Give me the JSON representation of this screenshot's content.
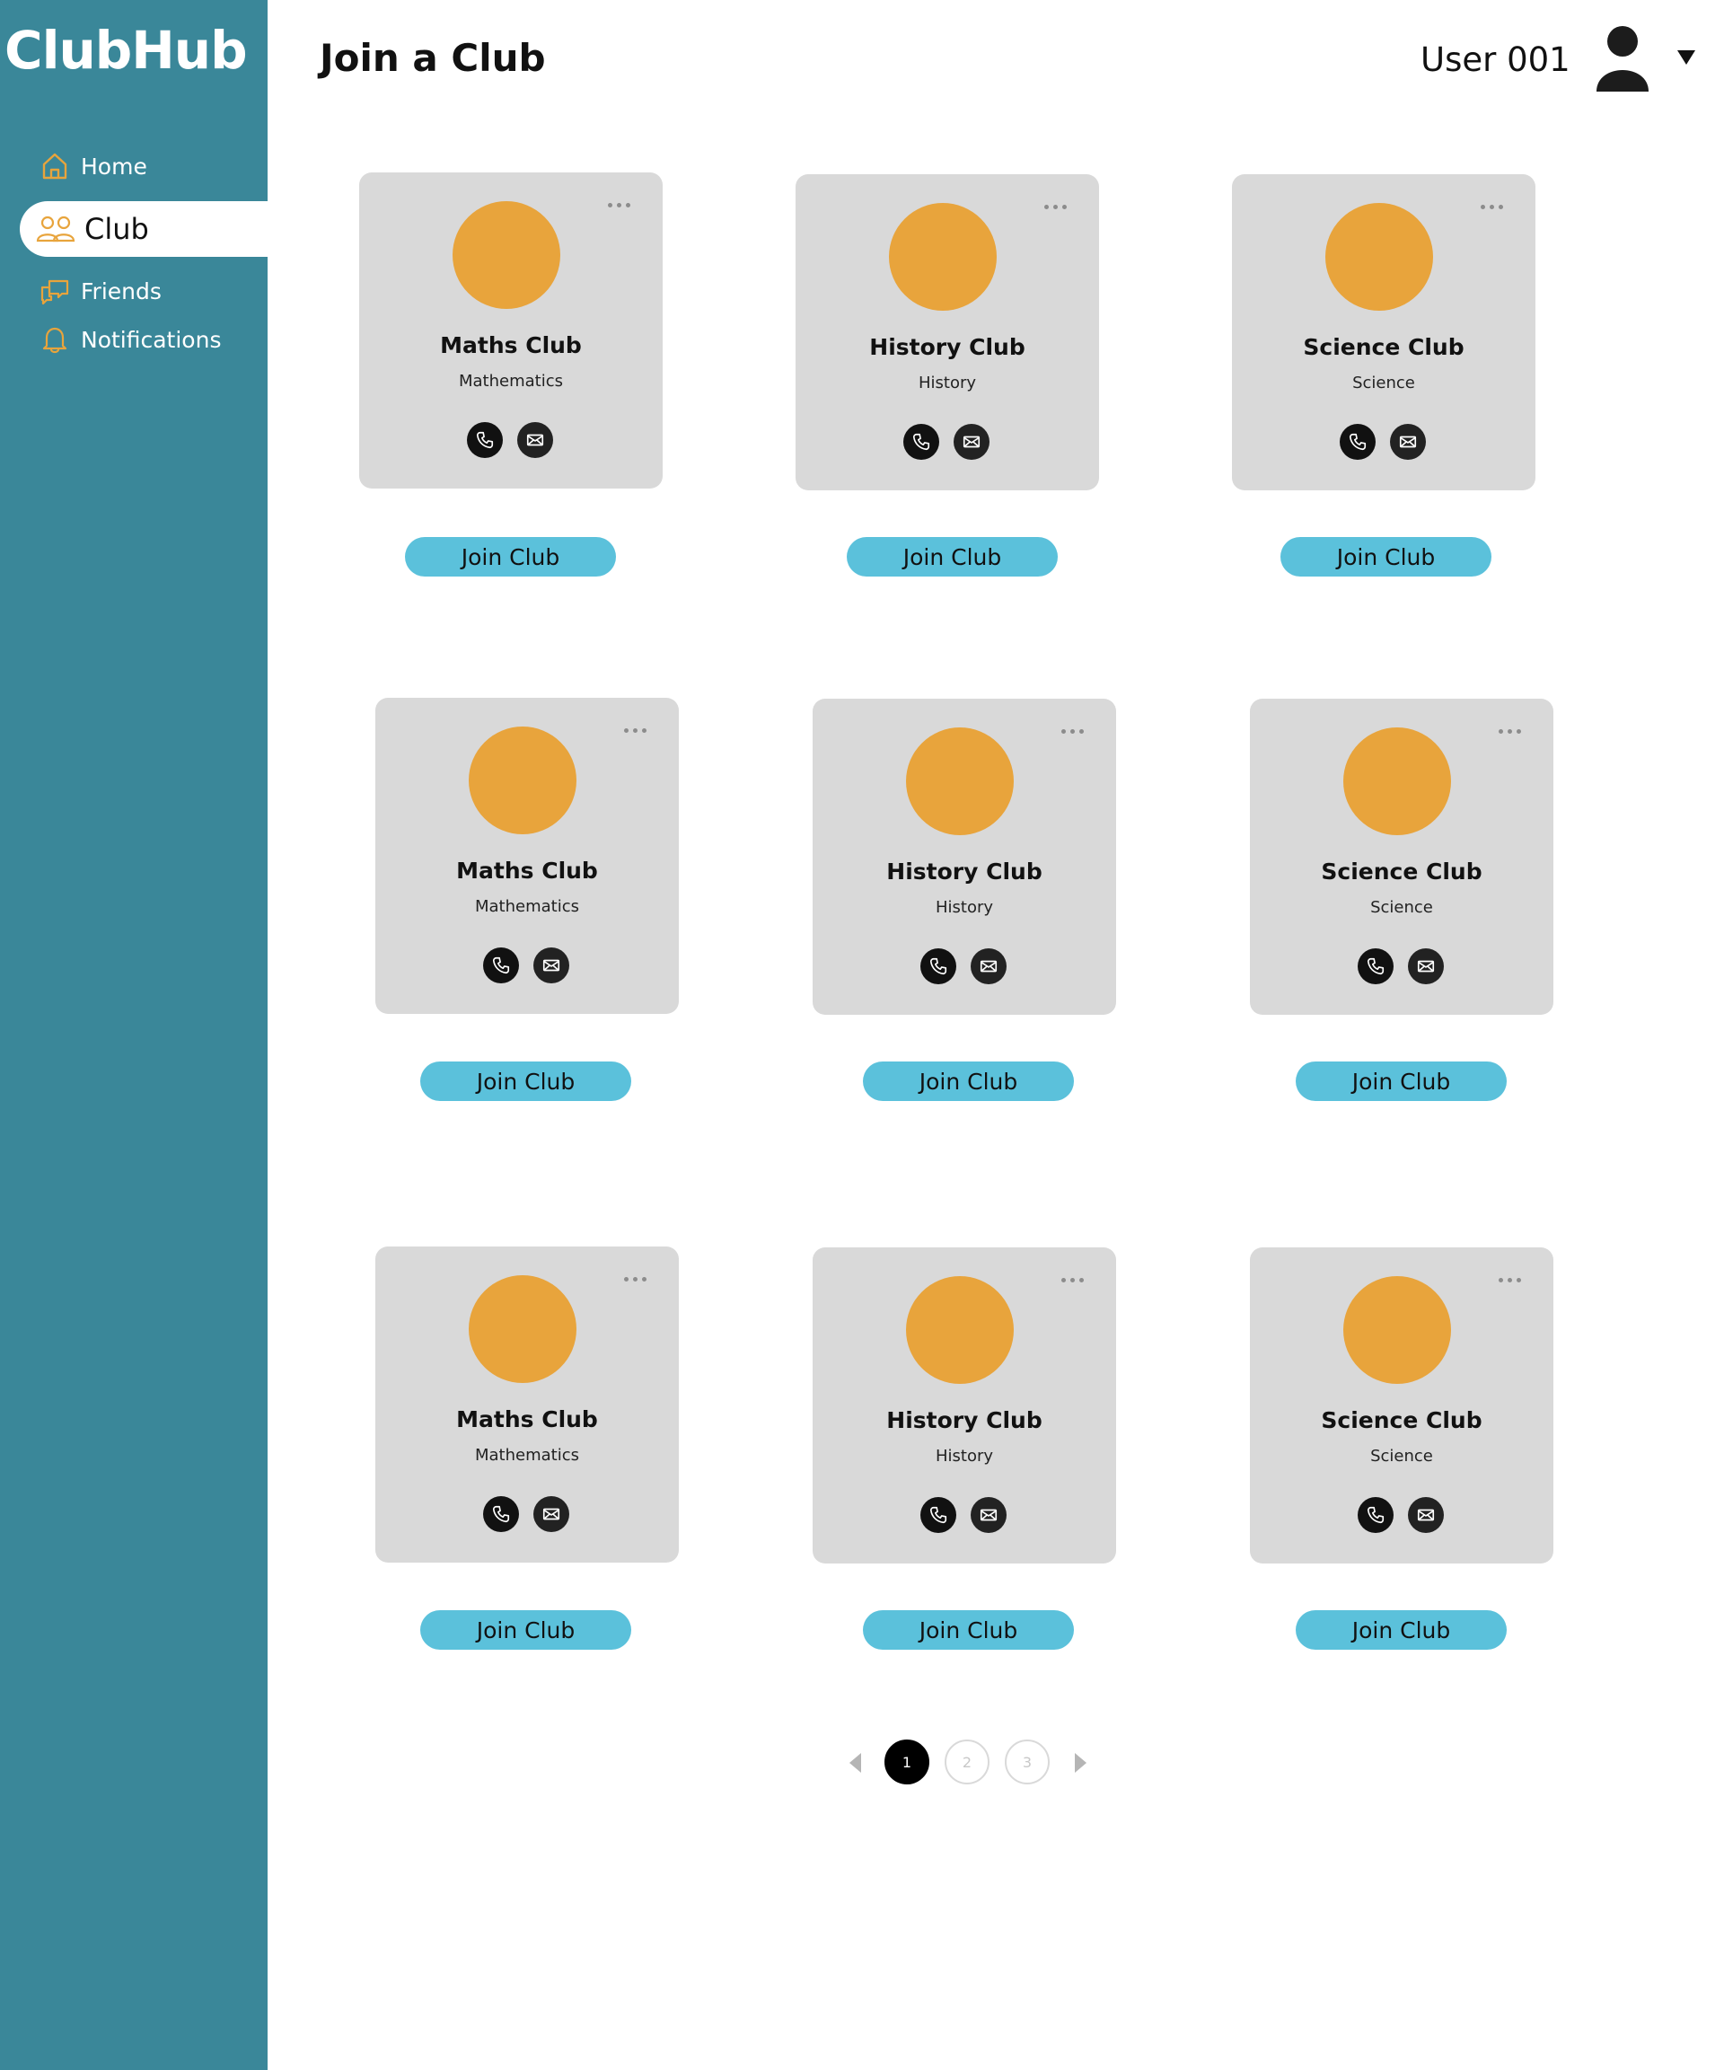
{
  "app": {
    "logo": "ClubHub",
    "page_title": "Join a Club"
  },
  "sidebar": {
    "items": [
      {
        "label": "Home",
        "icon": "home-icon"
      },
      {
        "label": "Club",
        "icon": "users-icon",
        "active": true
      },
      {
        "label": "Friends",
        "icon": "chat-icon"
      },
      {
        "label": "Notifications",
        "icon": "bell-icon"
      }
    ]
  },
  "header": {
    "username": "User 001",
    "avatar_icon": "user-avatar-icon",
    "dropdown_icon": "caret-down-icon"
  },
  "clubs": [
    {
      "name": "Maths Club",
      "subject": "Mathematics",
      "button": "Join Club"
    },
    {
      "name": "History Club",
      "subject": "History",
      "button": "Join Club"
    },
    {
      "name": "Science Club",
      "subject": "Science",
      "button": "Join Club"
    },
    {
      "name": "Maths Club",
      "subject": "Mathematics",
      "button": "Join Club"
    },
    {
      "name": "History Club",
      "subject": "History",
      "button": "Join Club"
    },
    {
      "name": "Science Club",
      "subject": "Science",
      "button": "Join Club"
    },
    {
      "name": "Maths Club",
      "subject": "Mathematics",
      "button": "Join Club"
    },
    {
      "name": "History Club",
      "subject": "History",
      "button": "Join Club"
    },
    {
      "name": "Science Club",
      "subject": "Science",
      "button": "Join Club"
    }
  ],
  "pagination": {
    "pages": [
      "1",
      "2",
      "3"
    ],
    "current": "1"
  },
  "colors": {
    "sidebar": "#3a8799",
    "accent": "#e8a43c",
    "button": "#5bc1db",
    "card": "#d9d9d9"
  }
}
